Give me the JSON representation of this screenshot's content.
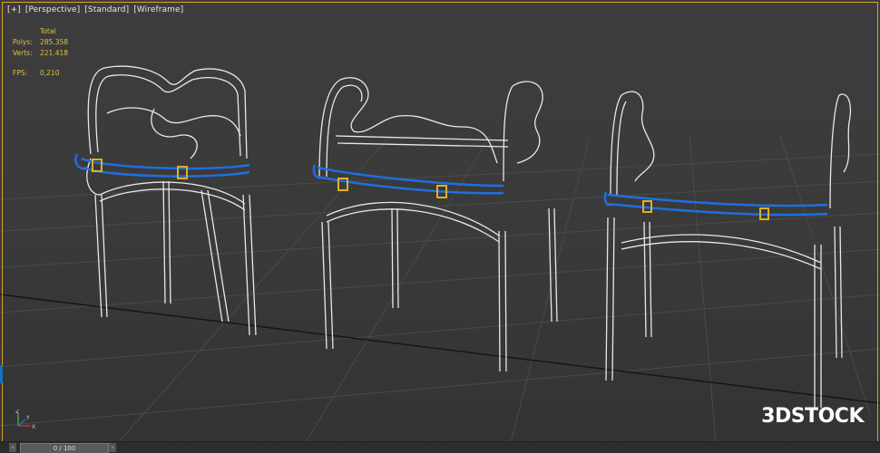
{
  "viewport": {
    "labels": [
      "[+]",
      "[Perspective]",
      "[Standard]",
      "[Wireframe]"
    ]
  },
  "stats": {
    "total_header": "Total",
    "polys_label": "Polys:",
    "polys_value": "285.358",
    "verts_label": "Verts:",
    "verts_value": "221.418",
    "fps_label": "FPS:",
    "fps_value": "0,210"
  },
  "watermark": "3DSTOCK",
  "timeline": {
    "slider_text": "0 / 100",
    "prev_icon": "‹",
    "next_icon": "›"
  },
  "axis_gizmo": {
    "x": "X",
    "y": "Y",
    "z": "Z"
  },
  "colors": {
    "wire": "#e8e8e8",
    "selection": "#1f6fe0",
    "highlight": "#e0b020",
    "viewport_border": "#d8a51a"
  }
}
